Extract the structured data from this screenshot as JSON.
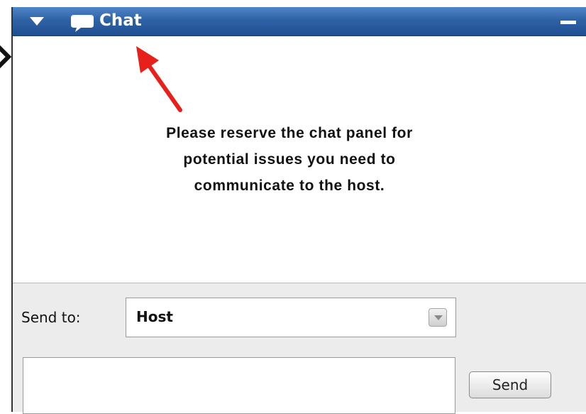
{
  "window": {
    "title": "Chat"
  },
  "notice": {
    "lines": [
      "Please reserve the chat panel for",
      "potential issues you need to",
      "communicate to the host."
    ]
  },
  "composer": {
    "send_to_label": "Send to:",
    "recipient": {
      "selected": "Host"
    },
    "message_input": {
      "value": "",
      "placeholder": ""
    },
    "send_label": "Send"
  },
  "icons": {
    "collapse": "triangle-down-icon",
    "chat": "speech-bubble-icon",
    "minimize": "minimize-icon",
    "dropdown": "chevron-down-icon",
    "annotation": "red-arrow-icon"
  },
  "colors": {
    "titlebar": "#2e62a6",
    "annotation_arrow": "#e8201c",
    "composer_background": "#ececec"
  }
}
